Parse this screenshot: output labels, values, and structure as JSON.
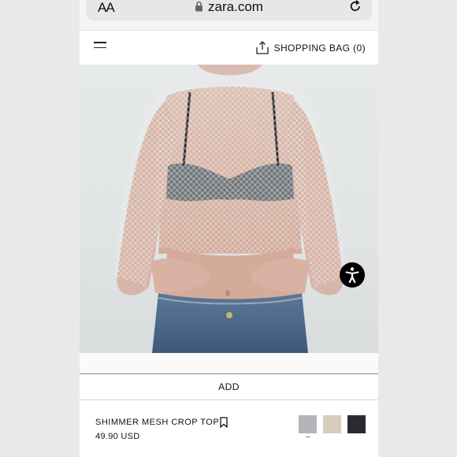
{
  "browser": {
    "text_size_label": "AA",
    "domain": "zara.com"
  },
  "header": {
    "menu_icon": "hamburger-menu-icon",
    "share_icon": "share-upload-icon",
    "bag_label": "SHOPPING BAG (0)"
  },
  "add_button": {
    "label": "ADD"
  },
  "product": {
    "name": "SHIMMER MESH CROP TOP",
    "price": "49.90 USD",
    "colors": [
      "#b4b4bb",
      "#d9ccbc",
      "#2b2b2f"
    ],
    "selected_color_index": 0
  },
  "accessibility_icon": "accessibility-person-icon"
}
